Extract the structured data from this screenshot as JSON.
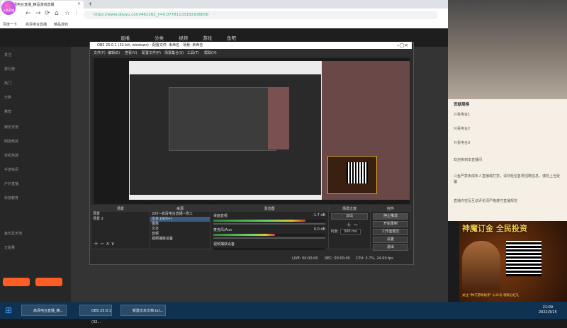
{
  "browser": {
    "tab_title": "高清电台直播_精品游戏直播",
    "tab_close": "×",
    "new_tab": "+",
    "url": "https://www.douyu.com/462262_t=0.07781133182936658",
    "bookmarks": [
      "百度一下",
      "高清电台直播",
      "精品游戏"
    ]
  },
  "site": {
    "logo_text": "斗鱼直播",
    "nav": [
      "直播",
      "分类",
      "视频",
      "游戏",
      "鱼吧"
    ],
    "sidebar_items": [
      "关注",
      "排行榜",
      "热门",
      "分类",
      "推荐",
      "娱乐天地",
      "网游竞技",
      "单机热游",
      "手游休闲",
      "户外直播",
      "科技教育",
      "鱼乐星天地",
      "正能量"
    ]
  },
  "obs": {
    "title": "OBS 25.0.1 (32-bit, windows) - 配置文件: 未命名 - 场景: 未命名",
    "menu": [
      "文件(F)",
      "编辑(E)",
      "查看(V)",
      "配置文件(P)",
      "场景集合(S)",
      "工具(T)",
      "帮助(H)"
    ],
    "scenes_header": "场景",
    "scenes": [
      "场景",
      "场景 2"
    ],
    "sources_header": "来源",
    "sources": [
      "200~高清电台直播~修工",
      "文本 (GDI+)",
      "图像",
      "文本",
      "音频",
      "视频捕获设备"
    ],
    "mixer_header": "混音器",
    "mixer_tracks": [
      {
        "label": "桌面音频",
        "db": "-1.7 dB",
        "level": 0.82
      },
      {
        "label": "麦克风/Aux",
        "db": "0.0 dB",
        "level": 0.55
      },
      {
        "label": "视频捕获设备",
        "db": "",
        "level": 0.0
      }
    ],
    "transitions_header": "场景过渡",
    "transition_type": "淡出",
    "duration_label": "时长",
    "duration_value": "300 ms",
    "controls_header": "控件",
    "controls": [
      "停止推流",
      "开始录制",
      "工作室模式",
      "设置",
      "退出"
    ],
    "status": {
      "live": "LIVE: 00:00:00",
      "rec": "REC: 00:00:00",
      "cpu": "CPU: 3.7%, 24.00 fps"
    }
  },
  "chat": {
    "rank_title": "贡献周榜",
    "rank_items": [
      "只看电台1",
      "只看电台2",
      "只看电台3"
    ],
    "messages": [
      "欢迎来到本直播间",
      "斗鱼严禁未成年人直播或打赏，请勿轻信各类招聘信息，谨防上当受骗",
      "直播内容及互动评论须严格遵守直播规范"
    ]
  },
  "ad": {
    "title": "神魔订金 全民投资",
    "footer": "关注 \"种子游戏助手\" 公众号 领取分红礼"
  },
  "taskbar": {
    "tasks": [
      "高清电台直播_精...",
      "OBS 25.0.1 (32...",
      "新建文本文档.txt..."
    ],
    "time": "21:09",
    "date": "2022/3/15"
  },
  "colors": {
    "accent": "#ff5d23",
    "obs_select": "#3c5a80",
    "taskbar": "#0f3253"
  }
}
